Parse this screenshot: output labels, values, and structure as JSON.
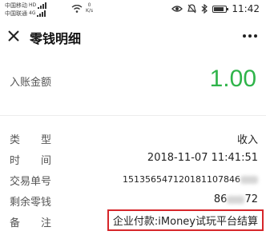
{
  "status_bar": {
    "carrier_1": "中国移动",
    "carrier_1_tag": "HD",
    "carrier_2": "中国联通",
    "carrier_2_tag": "4G",
    "net_speed_value": "0",
    "net_speed_unit": "K/s",
    "eye_icon": "eye-icon",
    "bell_icon": "bell-muted-icon",
    "bluetooth_icon": "bluetooth-icon",
    "battery_level": 0.85,
    "time": "11:42"
  },
  "header": {
    "title": "零钱明细",
    "close_icon": "close-icon",
    "more_icon": "more-dots-icon"
  },
  "amount": {
    "label": "入账金额",
    "value": "1.00",
    "color": "#2fb44a"
  },
  "details": {
    "type": {
      "label": [
        "类",
        "型"
      ],
      "value": "收入"
    },
    "time": {
      "label": [
        "时",
        "间"
      ],
      "value": "2018-11-07 11:41:51"
    },
    "order": {
      "label": "交易单号",
      "value": "151356547120181107846"
    },
    "balance": {
      "label": "剩余零钱",
      "value_prefix": "86",
      "value_suffix": "72"
    },
    "note": {
      "label": [
        "备",
        "注"
      ],
      "value": "企业付款:iMoney试玩平台结算"
    }
  },
  "highlight_color": "#d6262a"
}
